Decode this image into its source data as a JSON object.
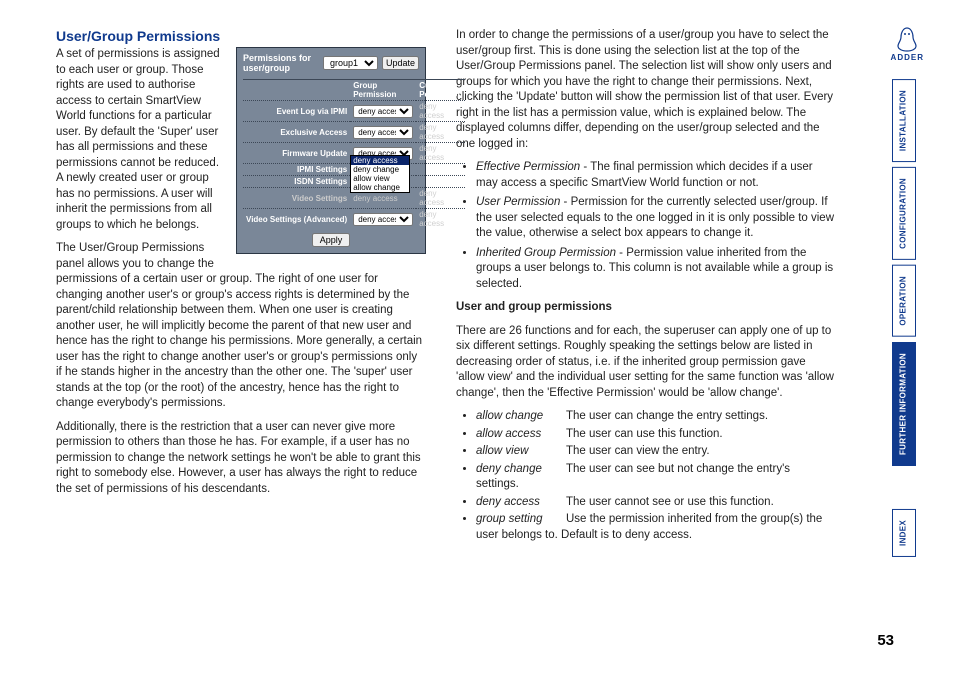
{
  "section": {
    "title": "User/Group Permissions",
    "para1": "A set of permissions is assigned to each user or group. Those rights are used to authorise access to certain SmartView World functions for a particular user. By default the 'Super' user has all permissions and these permissions cannot be reduced. A newly created user or group has no permissions. A user will inherit the permissions from all groups to which he belongs.",
    "para2": "The User/Group Permissions panel allows you to change the permissions of a certain user or group. The right of one user for changing another user's or group's access rights is determined by the parent/child relationship between them. When one user is creating another user, he will implicitly become the parent of that new user and hence has the right to change his permissions. More generally, a certain user has the right to change another user's or group's permissions only if he stands higher in the ancestry than the other one. The 'super' user stands at the top (or the root) of the ancestry, hence has the right to change everybody's permissions.",
    "para3": "Additionally, there is the restriction that a user can never give more permission to others than those he has. For example, if a user has no permission to change the network settings he won't be able to grant this right to somebody else. However, a user has always the right to reduce the set of permissions of his descendants."
  },
  "panel": {
    "header_label": "Permissions for user/group",
    "group_selected": "group1",
    "update_btn": "Update",
    "col_group": "Group Permission",
    "col_current": "Current Permission",
    "rows": {
      "event_log": "Event Log via IPMI",
      "exclusive": "Exclusive Access",
      "firmware": "Firmware Update",
      "ipmi": "IPMI Settings",
      "isdn": "ISDN Settings",
      "video": "Video Settings",
      "video_adv": "Video Settings (Advanced)"
    },
    "deny_access": "deny access",
    "deny_change": "deny change",
    "allow_view": "allow view",
    "allow_change": "allow change",
    "apply_btn": "Apply"
  },
  "right": {
    "intro": "In order to change the permissions of a user/group you have to select the user/group first. This is done using the selection list at the top of the User/Group Permissions panel. The selection list will show only users and groups for which you have the right to change their permissions. Next, clicking the 'Update' button will show the permission list of that user. Every right in the list has a permission value, which is explained below. The displayed columns differ, depending on the user/group selected and the one logged in:",
    "bul1_term": "Effective Permission",
    "bul1_text": " - The final permission which decides if a user may access a specific SmartView World function or not.",
    "bul2_term": "User Permission",
    "bul2_text": " - Permission for the currently selected user/group. If the user selected equals to the one logged in it is only possible to view the value, otherwise a select box appears to change it.",
    "bul3_term": "Inherited Group Permission",
    "bul3_text": " - Permission value inherited from the groups a user belongs to. This column is not available while a group is selected.",
    "subheading": "User and group permissions",
    "subpara": "There are 26 functions and for each, the superuser can apply one of up to six different settings. Roughly speaking the settings below are listed in decreasing order of status, i.e. if the inherited group permission gave 'allow view' and the individual user setting for the same function was 'allow change', then the 'Effective Permission' would be 'allow change'.",
    "settings": [
      {
        "term": "allow change",
        "desc": "The user can change the entry settings."
      },
      {
        "term": "allow access",
        "desc": "The user can use this function."
      },
      {
        "term": "allow view",
        "desc": "The user can view the entry."
      },
      {
        "term": "deny change",
        "desc": "The user can see but not change the entry's settings."
      },
      {
        "term": "deny access",
        "desc": "The user cannot see or use this function."
      },
      {
        "term": "group setting",
        "desc": "Use the permission inherited from the group(s) the user belongs to. Default is to deny access."
      }
    ]
  },
  "tabs": {
    "installation": "INSTALLATION",
    "configuration": "CONFIGURATION",
    "operation": "OPERATION",
    "further": "FURTHER INFORMATION",
    "index": "INDEX"
  },
  "logo_text": "ADDER",
  "page_number": "53"
}
